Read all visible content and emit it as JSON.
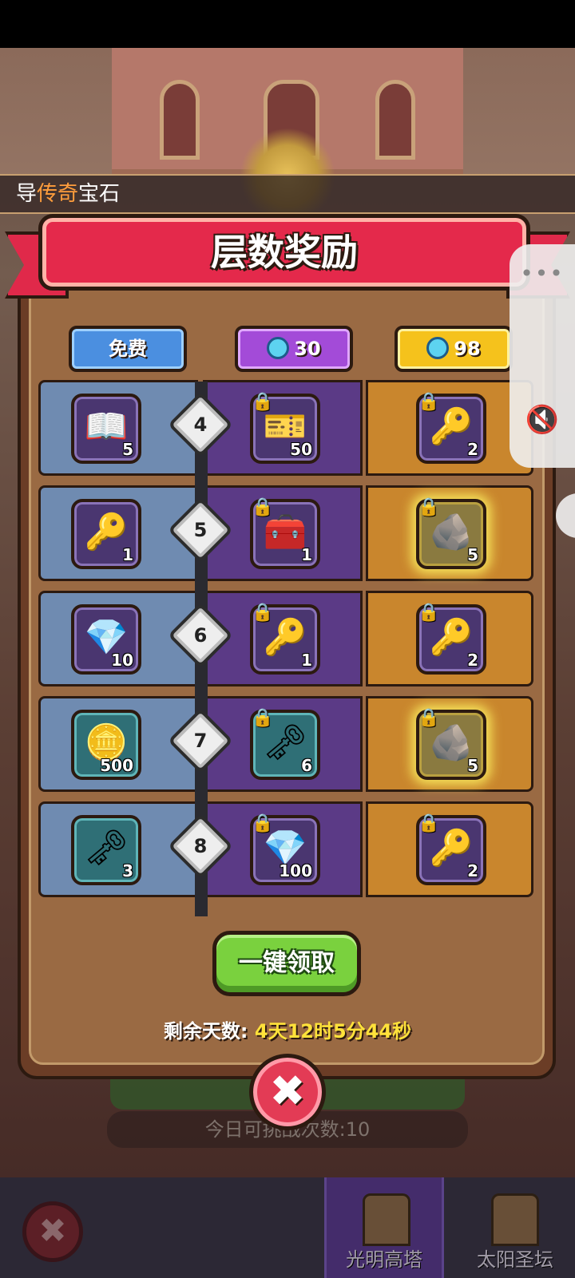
{
  "notice": {
    "pre": "导",
    "highlight": "传奇",
    "post": "宝石"
  },
  "dialog": {
    "title": "层数奖励",
    "tiers": {
      "free": "免费",
      "purple": "30",
      "gold": "98"
    },
    "rows": [
      {
        "level": "4",
        "free": {
          "icon": "book-icon",
          "qty": "5"
        },
        "purple": {
          "icon": "crown-ticket-icon",
          "qty": "50"
        },
        "gold": {
          "icon": "gold-key-icon",
          "qty": "2"
        }
      },
      {
        "level": "5",
        "free": {
          "icon": "gold-key-icon",
          "qty": "1"
        },
        "purple": {
          "icon": "chest-icon",
          "qty": "1"
        },
        "gold": {
          "icon": "rune-stone-icon",
          "qty": "5"
        }
      },
      {
        "level": "6",
        "free": {
          "icon": "gem-icon",
          "qty": "10"
        },
        "purple": {
          "icon": "gold-key-icon",
          "qty": "1"
        },
        "gold": {
          "icon": "gold-key-icon",
          "qty": "2"
        }
      },
      {
        "level": "7",
        "free": {
          "icon": "coin-icon",
          "qty": "500"
        },
        "purple": {
          "icon": "silver-key-icon",
          "qty": "6"
        },
        "gold": {
          "icon": "rune-stone-icon",
          "qty": "5"
        }
      },
      {
        "level": "8",
        "free": {
          "icon": "silver-key-icon",
          "qty": "3"
        },
        "purple": {
          "icon": "gem-icon",
          "qty": "100"
        },
        "gold": {
          "icon": "gold-key-icon",
          "qty": "2"
        }
      }
    ],
    "claim_label": "一键领取",
    "remaining_label": "剩余天数:",
    "remaining_value": "4天12时5分44秒",
    "close_glyph": "✖"
  },
  "background": {
    "challenge_count": "今日可挑战次数:10"
  },
  "tabbar": {
    "tower": "光明高塔",
    "altar": "太阳圣坛"
  },
  "floating": {
    "more": "•••",
    "mute": "🔇"
  },
  "colors": {
    "banner": "#e4294b",
    "claim": "#7ad13e",
    "remaining": "#ffe23a",
    "free_tier": "#4b8fe0",
    "purple_tier": "#a34bd8",
    "gold_tier": "#f5c21c"
  }
}
